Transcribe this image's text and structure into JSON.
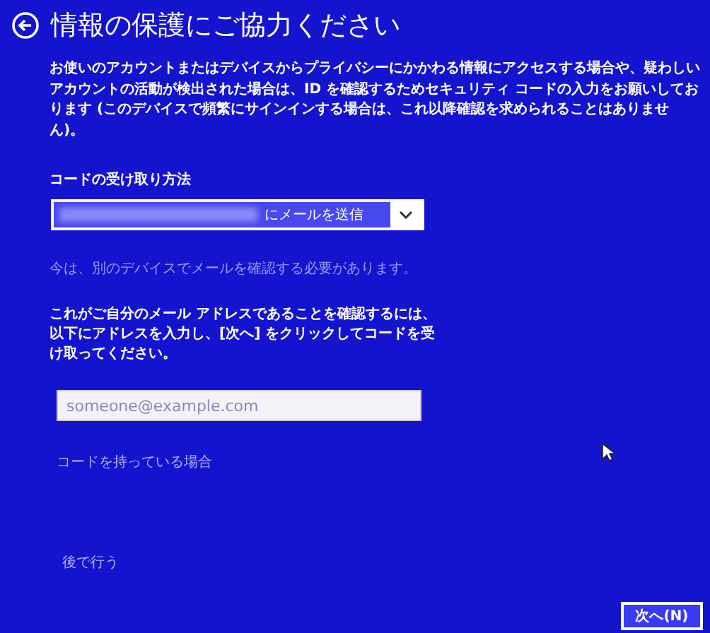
{
  "header": {
    "title": "情報の保護にご協力ください"
  },
  "intro": "お使いのアカウントまたはデバイスからプライバシーにかかわる情報にアクセスする場合や、疑わしいアカウントの活動が検出された場合は、ID を確認するためセキュリティ コードの入力をお願いしております (このデバイスで頻繁にサインインする場合は、これ以降確認を求められることはありません)。",
  "method": {
    "label": "コードの受け取り方法",
    "value_suffix": "にメールを送信"
  },
  "hint": "今は、別のデバイスでメールを確認する必要があります。",
  "instruction": "これがご自分のメール アドレスであることを確認するには、以下にアドレスを入力し、[次へ] をクリックしてコードを受け取ってください。",
  "email": {
    "placeholder": "someone@example.com"
  },
  "have_code_link": "コードを持っている場合",
  "later_link": "後で行う",
  "next_button": "次へ(N)"
}
